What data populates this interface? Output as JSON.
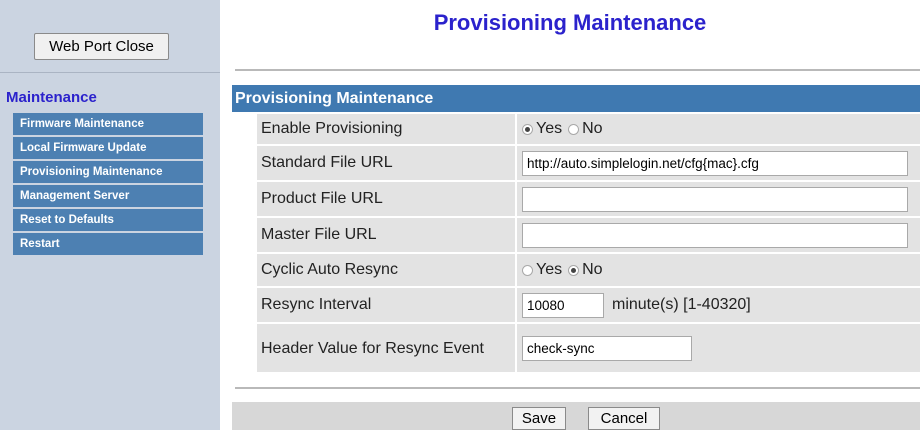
{
  "sidebar": {
    "web_port_close_label": "Web Port Close",
    "section_title": "Maintenance",
    "menu_items": [
      {
        "label": "Firmware Maintenance"
      },
      {
        "label": "Local Firmware Update"
      },
      {
        "label": "Provisioning Maintenance"
      },
      {
        "label": "Management Server"
      },
      {
        "label": "Reset to Defaults"
      },
      {
        "label": "Restart"
      }
    ]
  },
  "page": {
    "title": "Provisioning Maintenance",
    "panel_header": "Provisioning Maintenance"
  },
  "form": {
    "enable_provisioning": {
      "label": "Enable Provisioning",
      "yes_label": "Yes",
      "no_label": "No",
      "selected": "Yes"
    },
    "standard_file_url": {
      "label": "Standard File URL",
      "value": "http://auto.simplelogin.net/cfg{mac}.cfg"
    },
    "product_file_url": {
      "label": "Product File URL",
      "value": ""
    },
    "master_file_url": {
      "label": "Master File URL",
      "value": ""
    },
    "cyclic_auto_resync": {
      "label": "Cyclic Auto Resync",
      "yes_label": "Yes",
      "no_label": "No",
      "selected": "No"
    },
    "resync_interval": {
      "label": "Resync Interval",
      "value": "10080",
      "unit": "minute(s) [1-40320]"
    },
    "header_value": {
      "label": "Header Value for Resync Event",
      "value": "check-sync"
    }
  },
  "footer": {
    "save_label": "Save",
    "cancel_label": "Cancel"
  },
  "colors": {
    "sidebar_bg": "#cbd4e1",
    "menu_item_bg": "#4d80b2",
    "header_bg": "#3f79b1",
    "title_color": "#2b22cc"
  }
}
